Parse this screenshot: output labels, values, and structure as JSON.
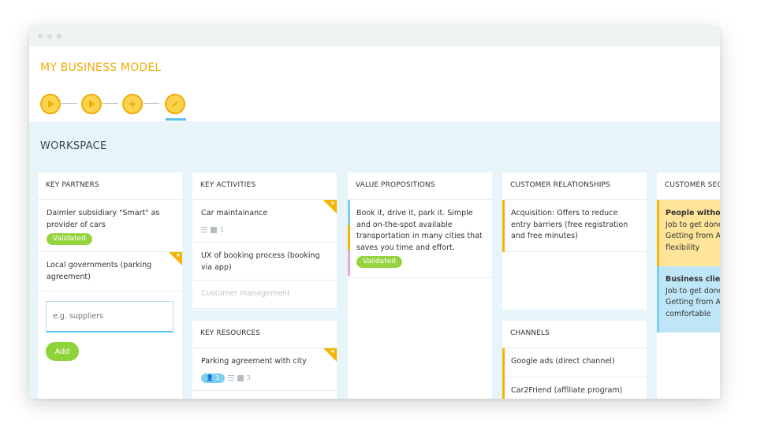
{
  "app": {
    "title": "MY BUSINESS MODEL"
  },
  "workspace": {
    "title": "WORKSPACE"
  },
  "key_partners": {
    "title": "KEY PARTNERS",
    "cards": [
      {
        "text": "Daimler subsidiary \"Smart\" as provider of cars",
        "badge": "Validated"
      },
      {
        "text": "Local governments (parking agreement)"
      }
    ],
    "input_placeholder": "e.g. suppliers",
    "add_label": "Add"
  },
  "key_activities": {
    "title": "KEY ACTIVITIES",
    "cards": [
      {
        "text": "Car maintainance",
        "doc_count": "1"
      },
      {
        "text": "UX of booking process (booking via app)"
      },
      {
        "text": "Customer management"
      }
    ]
  },
  "key_resources": {
    "title": "KEY RESOURCES",
    "cards": [
      {
        "text": "Parking agreement with city",
        "user_count": "1",
        "doc_count": "3"
      }
    ]
  },
  "value_propositions": {
    "title": "VALUE PROPOSITIONS",
    "cards": [
      {
        "text": "Book it, drive it, park it. Simple and on-the-spot available transportation in many cities that saves you time and effort.",
        "badge": "Validated"
      }
    ]
  },
  "customer_relationships": {
    "title": "CUSTOMER RELATIONSHIPS",
    "cards": [
      {
        "text": "Acquisition: Offers to reduce entry barriers (free registration and free minutes)"
      }
    ]
  },
  "channels": {
    "title": "CHANNELS",
    "cards": [
      {
        "text": "Google ads (direct channel)"
      },
      {
        "text": "Car2Friend (affiliate program)"
      }
    ]
  },
  "customer_segments": {
    "title": "CUSTOMER SEG",
    "cards": [
      {
        "title": "People without",
        "line1": "Job to get done",
        "line2": "Getting from A",
        "line3": "flexibility"
      },
      {
        "title": "Business client",
        "line1": "Job to get done",
        "line2": "Getting from A",
        "line3": "comfortable"
      }
    ]
  },
  "colors": {
    "accent": "#f0ad0a",
    "validated": "#95d43e",
    "blue": "#5bc0eb",
    "workspace_bg": "#e7f4fa",
    "segment_yellow": "#ffe59a",
    "segment_blue": "#bfe6f7"
  }
}
